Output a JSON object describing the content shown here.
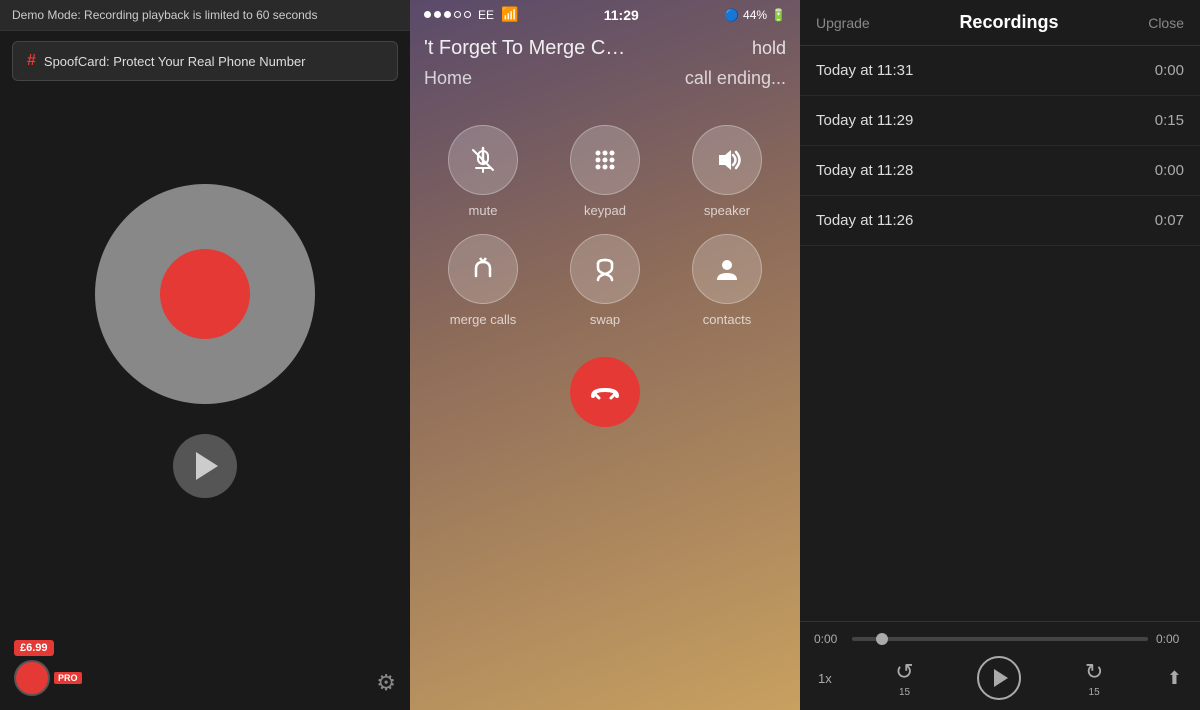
{
  "left": {
    "demo_banner": "Demo Mode: Recording playback is limited to 60 seconds",
    "spoof_card_text": "SpoofCard: Protect Your Real Phone Number",
    "price": "£6.99",
    "pro_label": "PRO"
  },
  "middle": {
    "status_bar": {
      "carrier": "EE",
      "time": "11:29",
      "battery": "44%"
    },
    "call_title": "'t Forget To Merge C…",
    "call_hold": "hold",
    "call_home": "Home",
    "call_ending": "call ending...",
    "buttons": [
      {
        "id": "mute",
        "label": "mute",
        "icon": "🎤"
      },
      {
        "id": "keypad",
        "label": "keypad",
        "icon": "⠿"
      },
      {
        "id": "speaker",
        "label": "speaker",
        "icon": "🔊"
      },
      {
        "id": "merge",
        "label": "merge calls",
        "icon": "⇈"
      },
      {
        "id": "swap",
        "label": "swap",
        "icon": "⇄"
      },
      {
        "id": "contacts",
        "label": "contacts",
        "icon": "👤"
      }
    ]
  },
  "right": {
    "header": {
      "upgrade_label": "Upgrade",
      "title": "Recordings",
      "close_label": "Close"
    },
    "recordings": [
      {
        "time": "Today at 11:31",
        "duration": "0:00"
      },
      {
        "time": "Today at 11:29",
        "duration": "0:15"
      },
      {
        "time": "Today at 11:28",
        "duration": "0:00"
      },
      {
        "time": "Today at 11:26",
        "duration": "0:07"
      }
    ],
    "playback": {
      "current_time": "0:00",
      "end_time": "0:00",
      "speed": "1x",
      "rewind_label": "15",
      "forward_label": "15"
    }
  }
}
